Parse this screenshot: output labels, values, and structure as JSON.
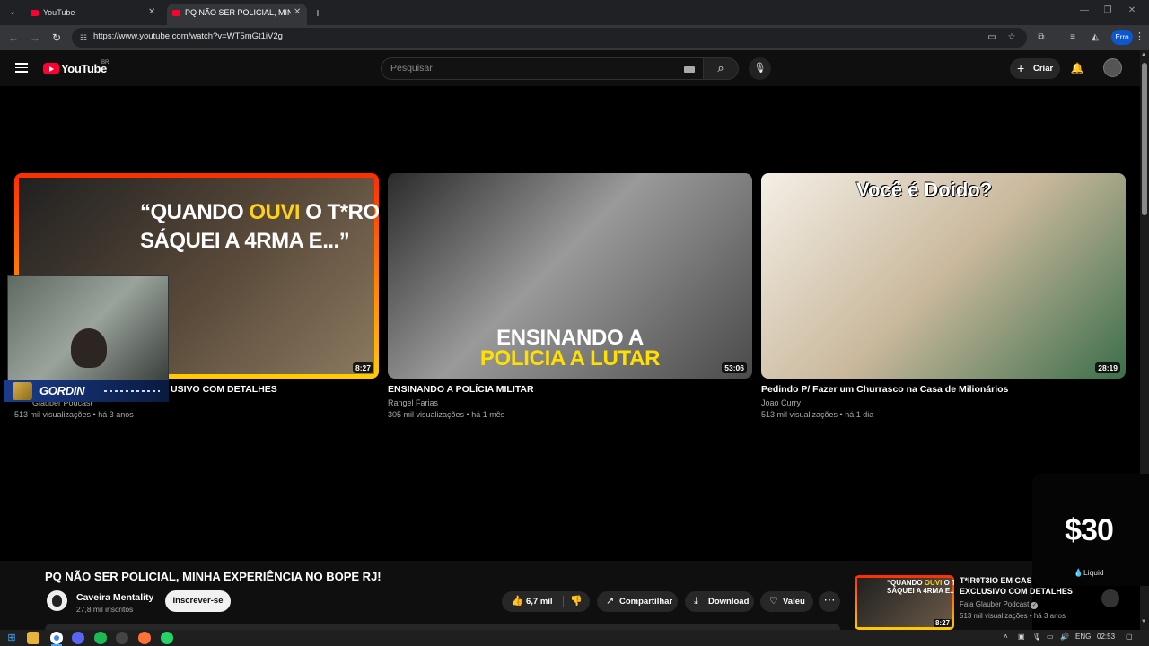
{
  "browser": {
    "tabs": [
      {
        "label": "YouTube",
        "active": false
      },
      {
        "label": "PQ NÃO SER POLICIAL, MINHA",
        "active": true
      }
    ],
    "url": "https://www.youtube.com/watch?v=WT5mGt1iV2g",
    "profile_label": "Erro"
  },
  "youtube": {
    "logo_text": "YouTube",
    "country_code": "BR",
    "search_placeholder": "Pesquisar",
    "create_label": "Criar"
  },
  "end_screen": {
    "videos": [
      {
        "thumb_lines": [
          "“QUANDO ",
          "OUVI",
          " O T*RO JÁ",
          "SÁQUEI A 4RMA E...”"
        ],
        "duration": "8:27",
        "title": "USIVO COM DETALHES",
        "channel": "Glauber Podcast",
        "meta": "513 mil visualizações • há 3 anos"
      },
      {
        "thumb_lines": [
          "ENSINANDO A",
          "POLICIA A LUTAR"
        ],
        "duration": "53:06",
        "title": "ENSINANDO A POLÍCIA MILITAR",
        "channel": "Rangel Farias",
        "meta": "305 mil visualizações • há 1 mês"
      },
      {
        "thumb_lines": [
          "Você é Doido?"
        ],
        "duration": "28:19",
        "title": "Pedindo P/ Fazer um Churrasco na Casa de Milionários",
        "channel": "Joao Curry",
        "meta": "513 mil visualizações • há 1 dia"
      }
    ]
  },
  "streamer_overlay": {
    "name": "GORDIN"
  },
  "video": {
    "title": "PQ NÃO SER POLICIAL, MINHA EXPERIÊNCIA NO BOPE RJ!",
    "channel": "Caveira Mentality",
    "subscribers": "27,8 mil inscritos",
    "subscribe_label": "Inscrever-se",
    "likes": "6,7 mil",
    "share_label": "Compartilhar",
    "download_label": "Download",
    "thanks_label": "Valeu"
  },
  "recommended": {
    "title": "T*IR0T3IO EM CAS EXCLUSIVO COM DETALHES",
    "channel": "Fala Glauber Podcast",
    "meta": "513 mil visualizações • há 3 anos",
    "duration": "8:27",
    "thumb_lines": [
      "“QUANDO ",
      "OUVI",
      " O T*RO JÁ",
      "SÁQUEI A 4RMA E...”"
    ]
  },
  "price_overlay": {
    "price": "$30",
    "brand": "Liquid"
  },
  "taskbar": {
    "lang": "ENG",
    "time": "02:53"
  },
  "icons": {
    "start": "windows-start-icon",
    "files": "file-explorer-icon",
    "chrome": "chrome-icon",
    "discord": "discord-icon",
    "spotify": "spotify-icon",
    "firefox": "firefox-icon",
    "whatsapp": "whatsapp-icon"
  }
}
